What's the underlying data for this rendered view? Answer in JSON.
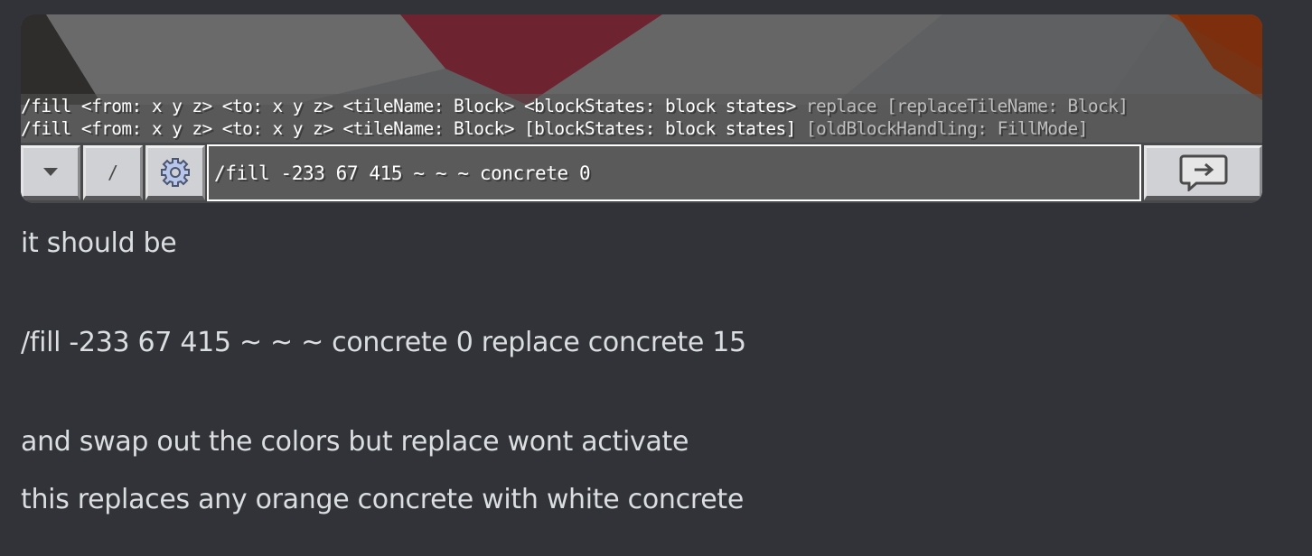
{
  "screenshot": {
    "hint_line_1": {
      "main": "/fill <from: x y z> <to: x y z> <tileName: Block> <blockStates: block states>",
      "dim": " replace [replaceTileName: Block]"
    },
    "hint_line_2": {
      "main": "/fill <from: x y z> <to: x y z> <tileName: Block> [blockStates: block states]",
      "dim": " [oldBlockHandling: FillMode]"
    },
    "toolbar": {
      "dropdown_icon": "triangle-down-icon",
      "slash_label": "/",
      "settings_icon": "gear-icon",
      "command_value": "/fill -233 67 415 ~ ~ ~ concrete 0",
      "send_icon": "send-arrow-icon"
    }
  },
  "messages": [
    "it should be",
    "/fill -233 67 415 ~ ~ ~ concrete 0 replace concrete 15",
    "and swap out the colors but replace wont activate",
    "this replaces any orange concrete with white concrete"
  ],
  "colors": {
    "background": "#313338",
    "message_text": "#dbdee1",
    "scene_red": "#7e2d35",
    "scene_orange": "#8a3a12"
  }
}
